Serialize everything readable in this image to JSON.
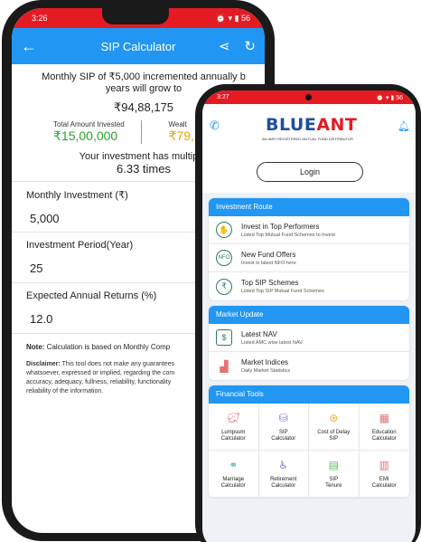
{
  "back_phone": {
    "status": {
      "time": "3:26",
      "battery": "56"
    },
    "appbar": {
      "title": "SIP Calculator",
      "back_icon": "arrow-left-icon",
      "share_icon": "share-icon",
      "refresh_icon": "refresh-icon"
    },
    "result": {
      "headline_line1": "Monthly SIP of ₹5,000 incremented annually b",
      "headline_line2": "years will grow to",
      "final_amount": "₹94,88,175",
      "total_invested_label": "Total Amount Invested",
      "total_invested_value": "₹15,00,000",
      "wealth_label": "Wealt",
      "wealth_value": "₹79,",
      "multiplier_line": "Your investment has multiplie",
      "multiplier_value": "6.33 times"
    },
    "fields": [
      {
        "label": "Monthly Investment (₹)",
        "value": "5,000"
      },
      {
        "label": "Investment Period(Year)",
        "value": "25"
      },
      {
        "label": "Expected Annual Returns (%)",
        "value": "12.0"
      }
    ],
    "note_bold": "Note:",
    "note_text": " Calculation is based on Monthly Comp",
    "disclaimer_bold": "Disclaimer:",
    "disclaimer_lines": [
      " This tool does not make any guarantees",
      "whatsoever, expressed or implied, regarding the com",
      "accuracy, adequacy, fullness, reliability, functionality",
      "reliability of the information."
    ]
  },
  "front_phone": {
    "status": {
      "time": "3:27",
      "battery": "56"
    },
    "logo": {
      "part1": "BLUE",
      "part2": "ANT",
      "tagline": "AN AMFI REGISTERED MUTUAL FUND DISTRIBUTOR"
    },
    "login_label": "Login",
    "investment_route": {
      "title": "Investment Route",
      "items": [
        {
          "title": "Invest in Top Performers",
          "subtitle": "Listed Top Mutual Fund Schemes to Invest",
          "icon": "handshake-icon"
        },
        {
          "title": "New Fund Offers",
          "subtitle": "Invest in latest NFO here",
          "icon": "nfo-icon"
        },
        {
          "title": "Top SIP Schemes",
          "subtitle": "Listed Top SIP Mutual Fund Schemes",
          "icon": "rupee-coin-icon"
        }
      ]
    },
    "market_update": {
      "title": "Market Update",
      "items": [
        {
          "title": "Latest NAV",
          "subtitle": "Listed AMC wise latest NAV",
          "icon": "money-icon"
        },
        {
          "title": "Market Indices",
          "subtitle": "Daily Market Statistics",
          "icon": "bar-chart-icon"
        }
      ]
    },
    "financial_tools": {
      "title": "Financial Tools",
      "tools": [
        {
          "line1": "Lumpsum",
          "line2": "Calculator",
          "icon": "piggy-bank-icon",
          "color": "#e57373"
        },
        {
          "line1": "SIP",
          "line2": "Calculator",
          "icon": "coins-icon",
          "color": "#9575cd"
        },
        {
          "line1": "Cost of Delay",
          "line2": "SIP",
          "icon": "clock-coin-icon",
          "color": "#f9a825"
        },
        {
          "line1": "Education",
          "line2": "Calculator",
          "icon": "calculator-icon",
          "color": "#e57373"
        },
        {
          "line1": "Marriage",
          "line2": "Calculator",
          "icon": "rings-icon",
          "color": "#4db6ac"
        },
        {
          "line1": "Retirement",
          "line2": "Calculator",
          "icon": "rocking-chair-icon",
          "color": "#9575cd"
        },
        {
          "line1": "SIP",
          "line2": "Tenure",
          "icon": "calendar-icon",
          "color": "#66bb6a"
        },
        {
          "line1": "EMI",
          "line2": "Calculator",
          "icon": "emi-calculator-icon",
          "color": "#e57373"
        }
      ]
    }
  }
}
